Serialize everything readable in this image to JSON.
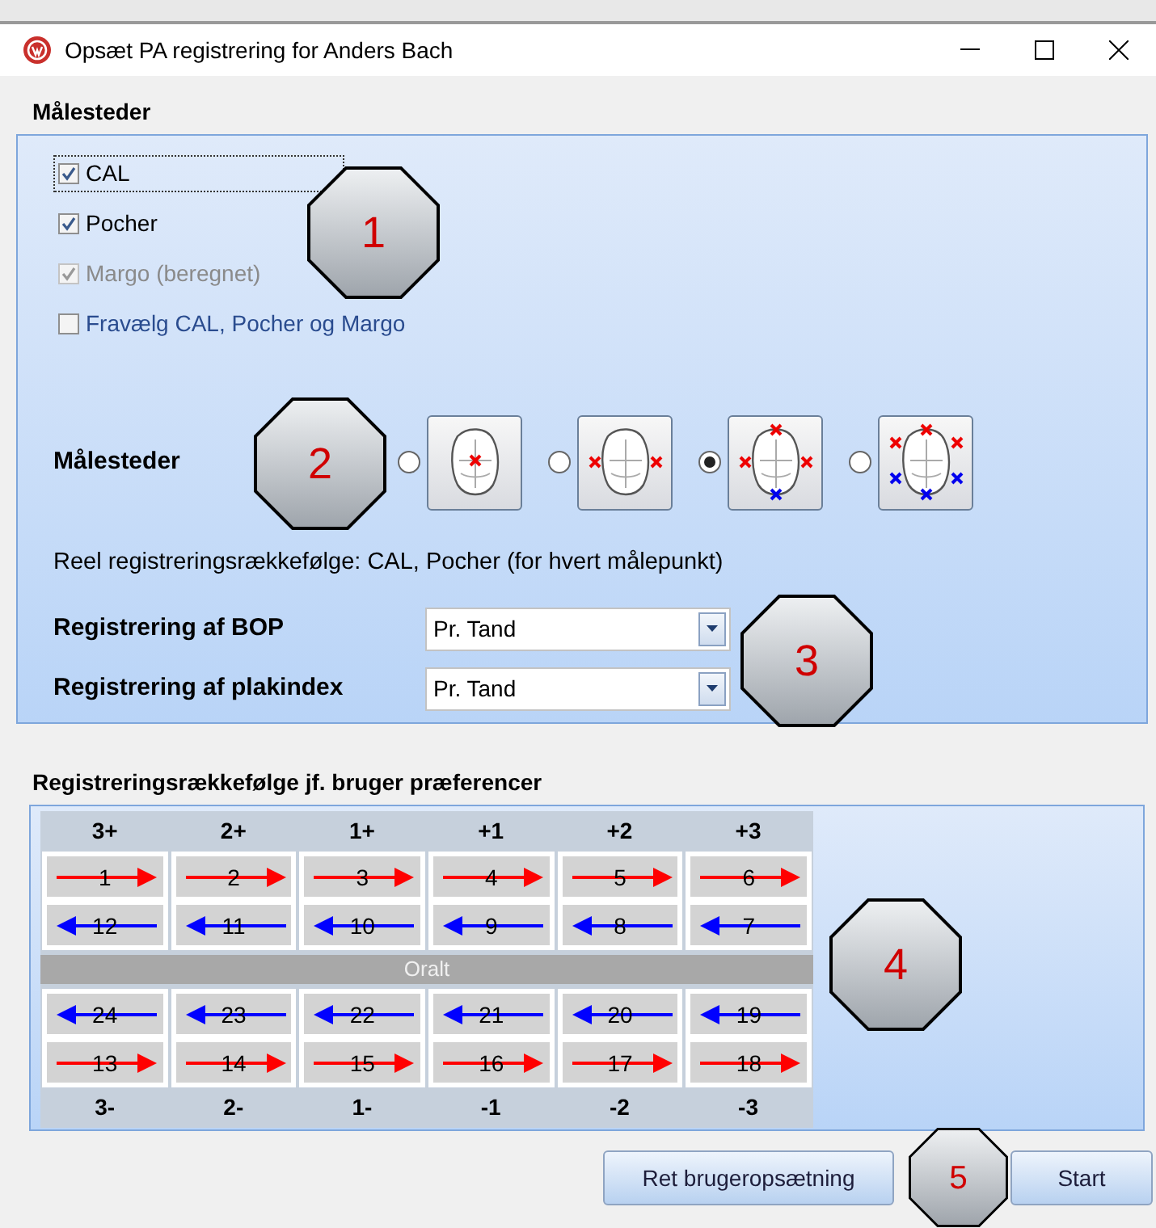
{
  "window": {
    "title": "Opsæt PA registrering for Anders Bach"
  },
  "measure_sites": {
    "heading": "Målesteder",
    "checkboxes": [
      {
        "label": "CAL",
        "checked": true,
        "disabled": false,
        "focused": true,
        "kind": "plain"
      },
      {
        "label": "Pocher",
        "checked": true,
        "disabled": false,
        "focused": false,
        "kind": "plain"
      },
      {
        "label": "Margo (beregnet)",
        "checked": true,
        "disabled": true,
        "focused": false,
        "kind": "plain"
      },
      {
        "label": "Fravælg CAL, Pocher og Margo",
        "checked": false,
        "disabled": false,
        "focused": false,
        "kind": "link"
      }
    ],
    "site_picker": {
      "label": "Målesteder",
      "options": [
        {
          "kind": "center",
          "selected": false
        },
        {
          "kind": "sides",
          "selected": false
        },
        {
          "kind": "four",
          "selected": true
        },
        {
          "kind": "six",
          "selected": false
        }
      ]
    },
    "order_text": "Reel registreringsrækkefølge: CAL, Pocher (for hvert målepunkt)",
    "selects": [
      {
        "label": "Registrering af BOP",
        "value": "Pr. Tand"
      },
      {
        "label": "Registrering af plakindex",
        "value": "Pr. Tand"
      }
    ]
  },
  "user_order": {
    "heading": "Registreringsrækkefølge jf. bruger præferencer",
    "top_labels": [
      "3+",
      "2+",
      "1+",
      "+1",
      "+2",
      "+3"
    ],
    "top_cells": [
      [
        {
          "number": "1",
          "kind": "right"
        },
        {
          "number": "12",
          "kind": "left"
        }
      ],
      [
        {
          "number": "2",
          "kind": "right"
        },
        {
          "number": "11",
          "kind": "left"
        }
      ],
      [
        {
          "number": "3",
          "kind": "right"
        },
        {
          "number": "10",
          "kind": "left"
        }
      ],
      [
        {
          "number": "4",
          "kind": "right"
        },
        {
          "number": "9",
          "kind": "left"
        }
      ],
      [
        {
          "number": "5",
          "kind": "right"
        },
        {
          "number": "8",
          "kind": "left"
        }
      ],
      [
        {
          "number": "6",
          "kind": "right"
        },
        {
          "number": "7",
          "kind": "left"
        }
      ]
    ],
    "middle_label": "Oralt",
    "bottom_cells": [
      [
        {
          "number": "24",
          "kind": "left"
        },
        {
          "number": "13",
          "kind": "right"
        }
      ],
      [
        {
          "number": "23",
          "kind": "left"
        },
        {
          "number": "14",
          "kind": "right"
        }
      ],
      [
        {
          "number": "22",
          "kind": "left"
        },
        {
          "number": "15",
          "kind": "right"
        }
      ],
      [
        {
          "number": "21",
          "kind": "left"
        },
        {
          "number": "16",
          "kind": "right"
        }
      ],
      [
        {
          "number": "20",
          "kind": "left"
        },
        {
          "number": "17",
          "kind": "right"
        }
      ],
      [
        {
          "number": "19",
          "kind": "left"
        },
        {
          "number": "18",
          "kind": "right"
        }
      ]
    ],
    "bottom_labels": [
      "3-",
      "2-",
      "1-",
      "-1",
      "-2",
      "-3"
    ]
  },
  "buttons": [
    "Ret brugeropsætning",
    "Start"
  ],
  "callouts": [
    "1",
    "2",
    "3",
    "4",
    "5"
  ]
}
